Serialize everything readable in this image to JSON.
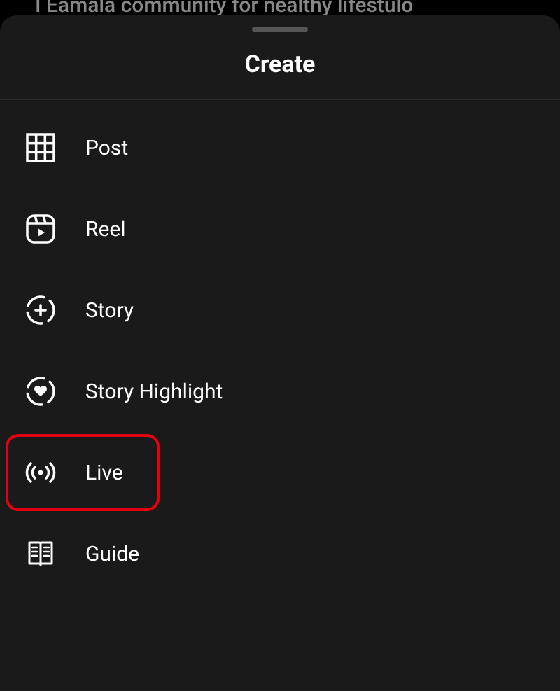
{
  "background": {
    "partial_text": "I Eamala community for nealthy lifestulo"
  },
  "sheet": {
    "title": "Create",
    "items": [
      {
        "label": "Post",
        "icon": "grid-icon"
      },
      {
        "label": "Reel",
        "icon": "reel-icon"
      },
      {
        "label": "Story",
        "icon": "story-plus-icon"
      },
      {
        "label": "Story Highlight",
        "icon": "story-heart-icon"
      },
      {
        "label": "Live",
        "icon": "live-icon"
      },
      {
        "label": "Guide",
        "icon": "guide-icon"
      }
    ]
  },
  "annotation": {
    "highlighted_item": "Live",
    "highlight_color": "#e3000f"
  }
}
